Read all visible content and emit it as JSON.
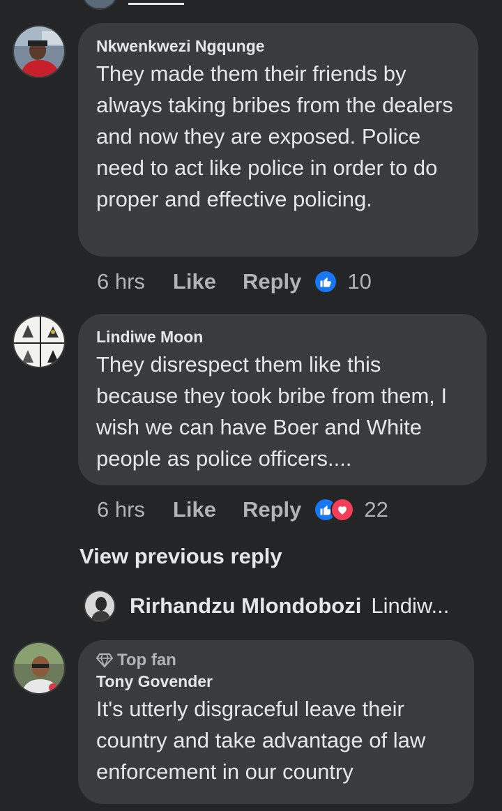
{
  "comments": [
    {
      "author": "Nkwenkwezi Ngqunge",
      "text": "They made them their friends by always taking bribes from the dealers and now they are exposed. Police need to act like police in order to do proper and effective policing.",
      "time": "6 hrs",
      "like_label": "Like",
      "reply_label": "Reply",
      "reactions": [
        "like-icon"
      ],
      "reaction_count": "10"
    },
    {
      "author": "Lindiwe Moon",
      "text": "They disrespect them like this because they took bribe from them, I wish we can have Boer and White people as police officers....",
      "time": "6 hrs",
      "like_label": "Like",
      "reply_label": "Reply",
      "reactions": [
        "like-icon",
        "love-icon"
      ],
      "reaction_count": "22"
    },
    {
      "badge": "Top fan",
      "author": "Tony Govender",
      "text": "It's utterly disgraceful leave their country and take advantage of law enforcement in our country"
    }
  ],
  "thread": {
    "view_previous_label": "View previous reply",
    "reply_preview": {
      "author": "Rirhandzu Mlondobozi",
      "snippet": "Lindiw..."
    }
  },
  "colors": {
    "background": "#242526",
    "bubble": "#3a3b3c",
    "text_primary": "#e4e6eb",
    "text_secondary": "#b0b3b8",
    "like_blue": "#1877f2",
    "love_red": "#f33e58"
  }
}
